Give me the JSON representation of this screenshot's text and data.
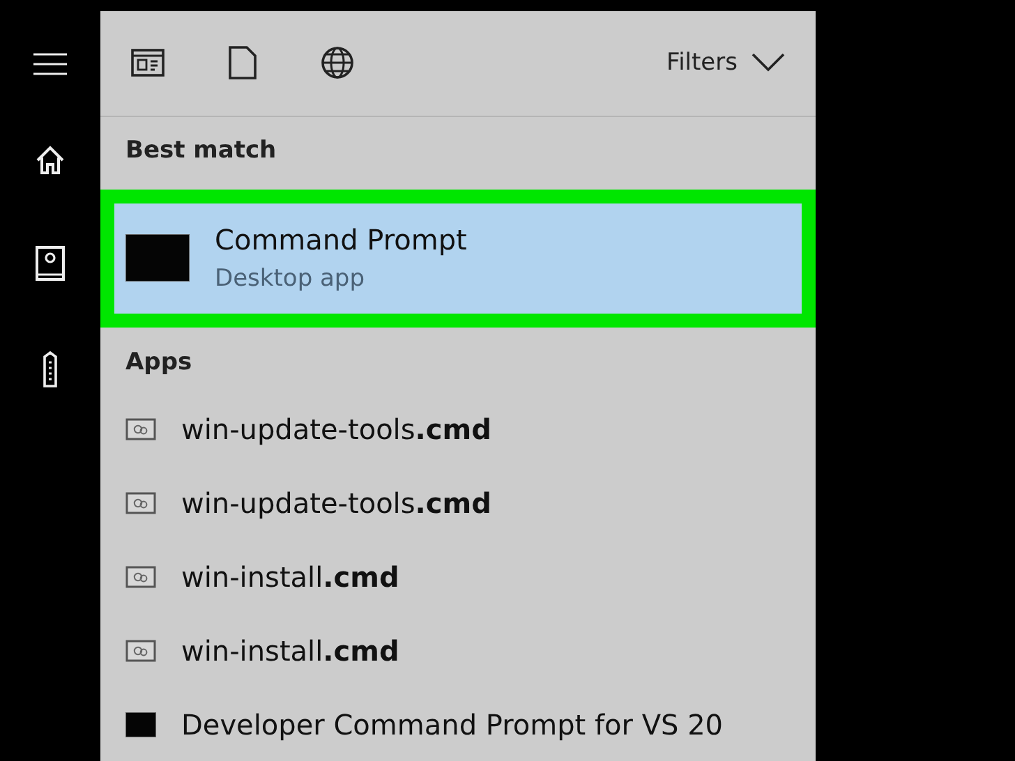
{
  "filters": {
    "label": "Filters"
  },
  "best_match": {
    "heading": "Best match",
    "title": "Command Prompt",
    "subtitle": "Desktop app"
  },
  "apps": {
    "heading": "Apps",
    "items": [
      {
        "kind": "script",
        "label": "win-update-tools**.cmd**"
      },
      {
        "kind": "script",
        "label": "win-update-tools**.cmd**"
      },
      {
        "kind": "script",
        "label": "win-install**.cmd**"
      },
      {
        "kind": "script",
        "label": "win-install**.cmd**"
      },
      {
        "kind": "console",
        "label": "Developer Command Prompt for VS 20"
      }
    ]
  }
}
